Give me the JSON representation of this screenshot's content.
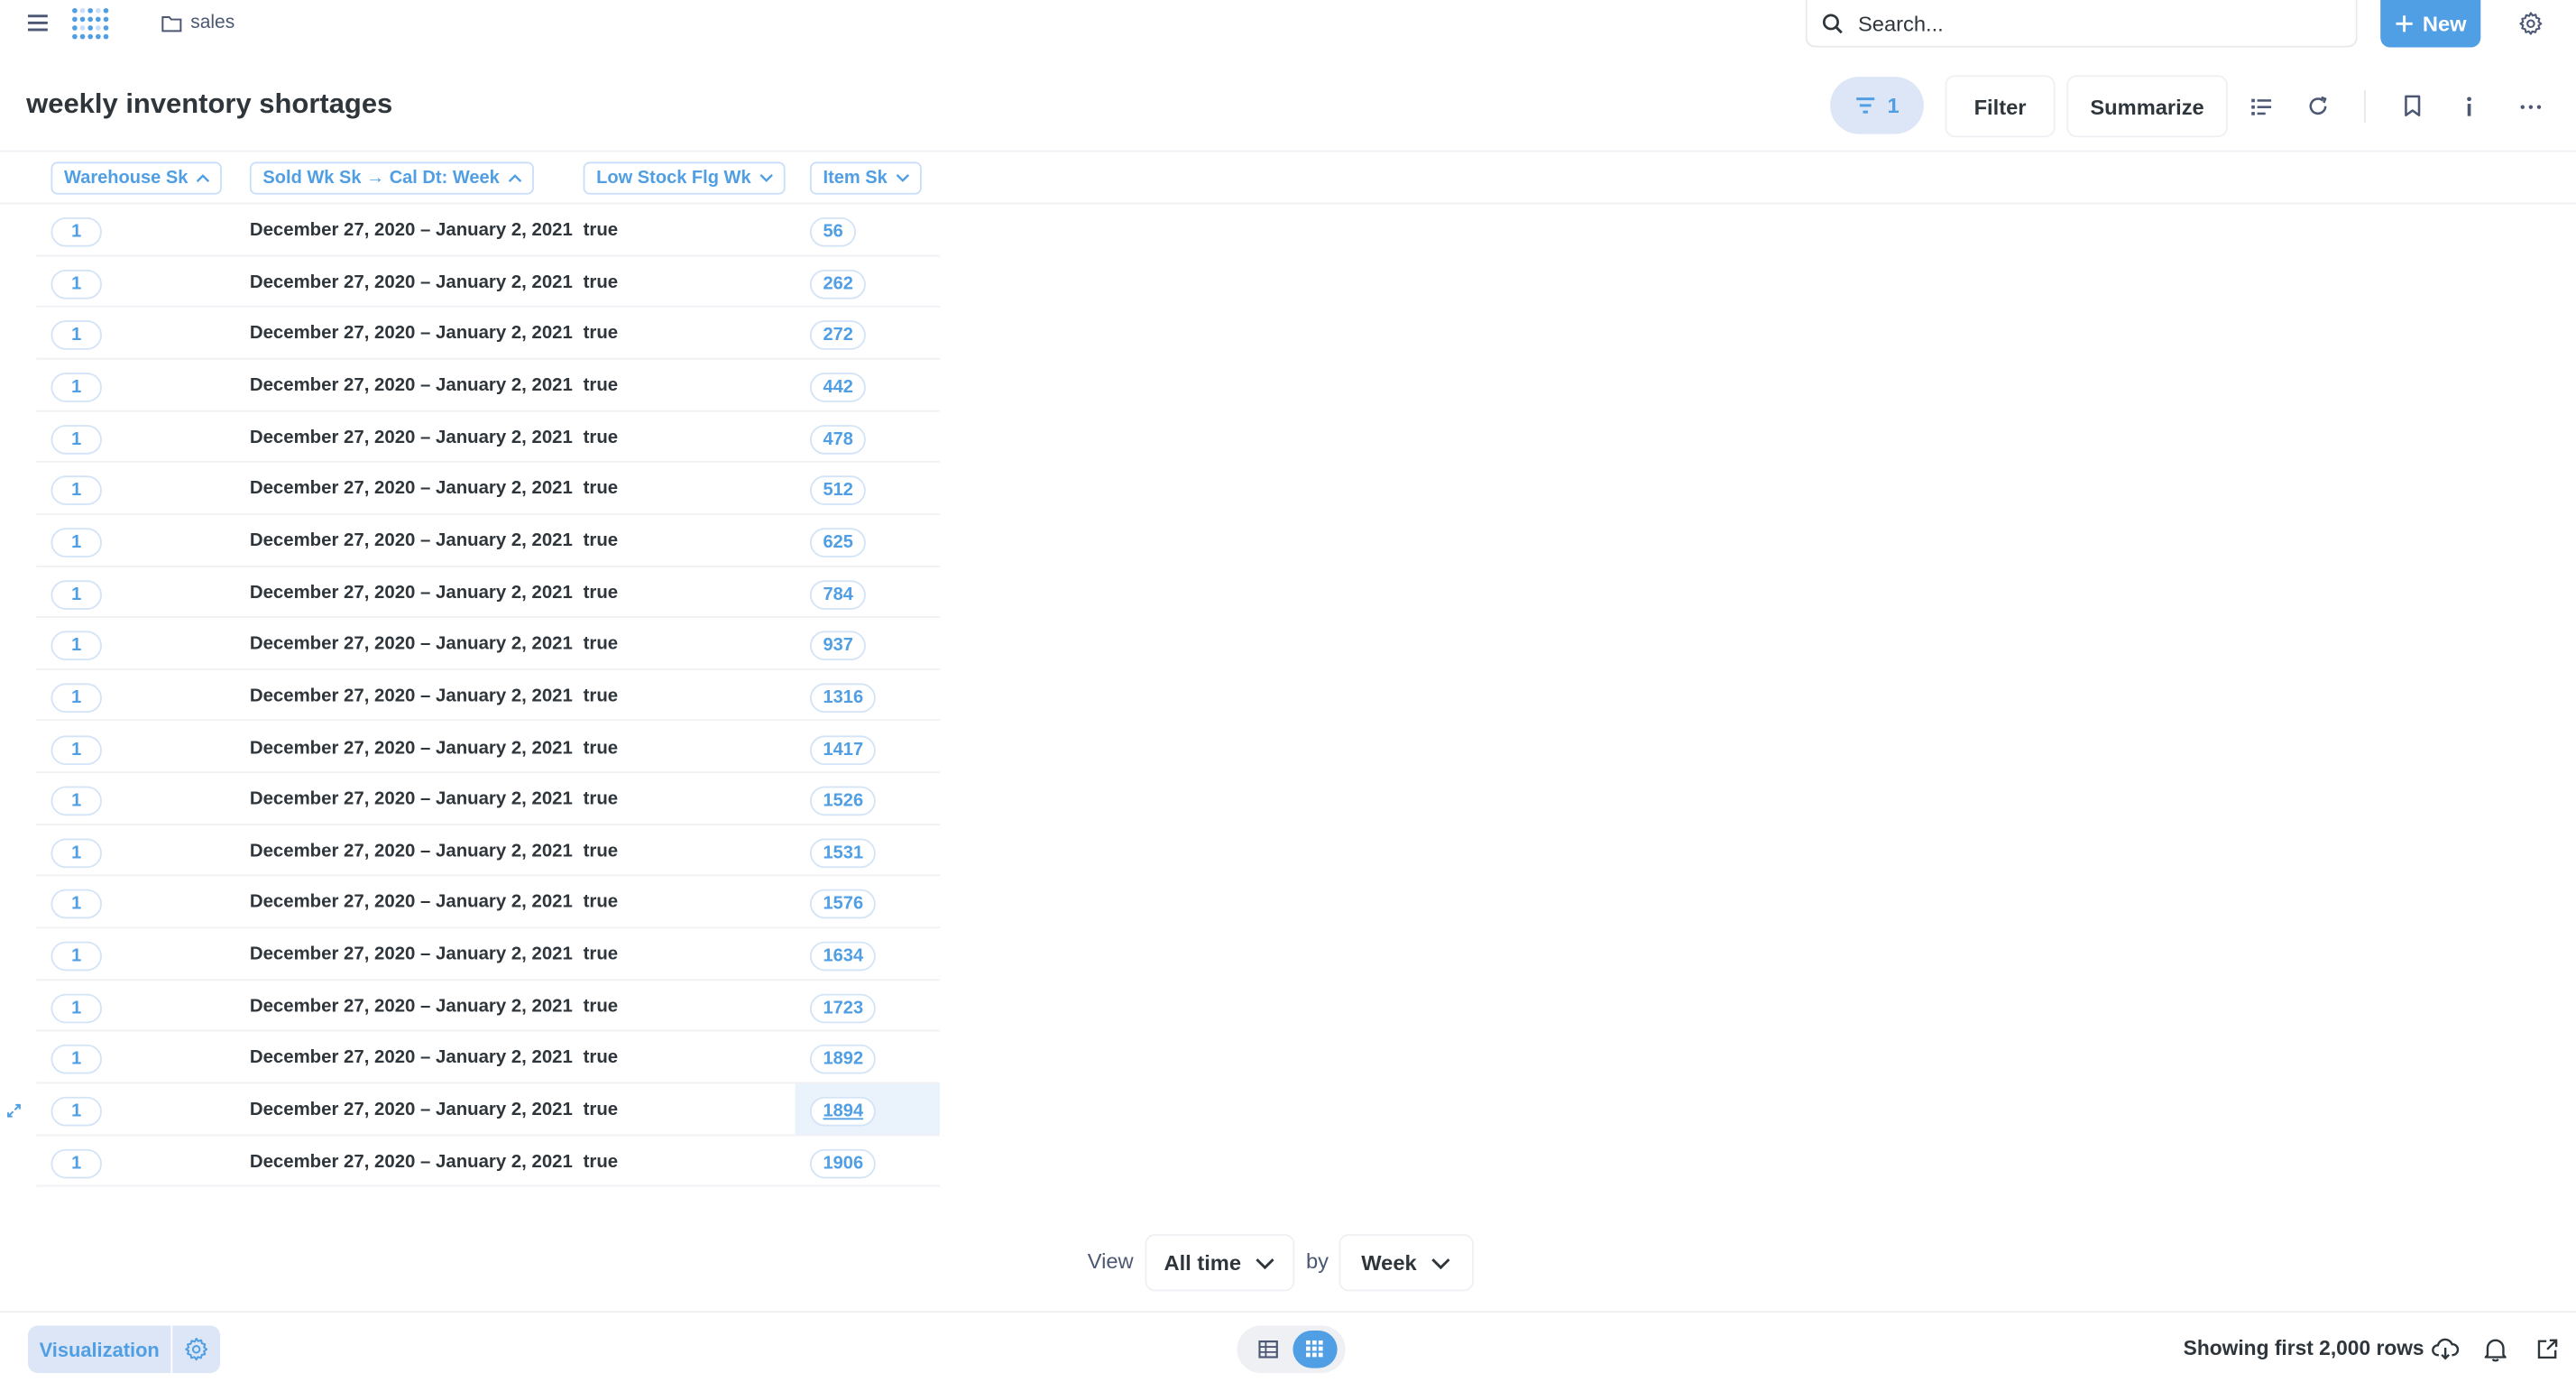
{
  "nav": {
    "breadcrumb": "sales",
    "search_placeholder": "Search...",
    "new_label": "New"
  },
  "header": {
    "title": "weekly inventory shortages",
    "filter_count": "1",
    "filter_label": "Filter",
    "summarize_label": "Summarize"
  },
  "table": {
    "columns": [
      {
        "label": "Warehouse Sk",
        "sort": "chevron-up"
      },
      {
        "label": "Sold Wk Sk → Cal Dt: Week",
        "sort": "chevron-up"
      },
      {
        "label": "Low Stock Flg Wk",
        "sort": "chevron-down"
      },
      {
        "label": "Item Sk",
        "sort": "chevron-down"
      }
    ],
    "rows": [
      [
        "1",
        "December 27, 2020 – January 2, 2021",
        "true",
        "56"
      ],
      [
        "1",
        "December 27, 2020 – January 2, 2021",
        "true",
        "262"
      ],
      [
        "1",
        "December 27, 2020 – January 2, 2021",
        "true",
        "272"
      ],
      [
        "1",
        "December 27, 2020 – January 2, 2021",
        "true",
        "442"
      ],
      [
        "1",
        "December 27, 2020 – January 2, 2021",
        "true",
        "478"
      ],
      [
        "1",
        "December 27, 2020 – January 2, 2021",
        "true",
        "512"
      ],
      [
        "1",
        "December 27, 2020 – January 2, 2021",
        "true",
        "625"
      ],
      [
        "1",
        "December 27, 2020 – January 2, 2021",
        "true",
        "784"
      ],
      [
        "1",
        "December 27, 2020 – January 2, 2021",
        "true",
        "937"
      ],
      [
        "1",
        "December 27, 2020 – January 2, 2021",
        "true",
        "1316"
      ],
      [
        "1",
        "December 27, 2020 – January 2, 2021",
        "true",
        "1417"
      ],
      [
        "1",
        "December 27, 2020 – January 2, 2021",
        "true",
        "1526"
      ],
      [
        "1",
        "December 27, 2020 – January 2, 2021",
        "true",
        "1531"
      ],
      [
        "1",
        "December 27, 2020 – January 2, 2021",
        "true",
        "1576"
      ],
      [
        "1",
        "December 27, 2020 – January 2, 2021",
        "true",
        "1634"
      ],
      [
        "1",
        "December 27, 2020 – January 2, 2021",
        "true",
        "1723"
      ],
      [
        "1",
        "December 27, 2020 – January 2, 2021",
        "true",
        "1892"
      ],
      [
        "1",
        "December 27, 2020 – January 2, 2021",
        "true",
        "1894"
      ],
      [
        "1",
        "December 27, 2020 – January 2, 2021",
        "true",
        "1906"
      ]
    ],
    "hovered_row": 17
  },
  "view_controls": {
    "view_label": "View",
    "time_value": "All time",
    "by_label": "by",
    "unit_value": "Week"
  },
  "footer": {
    "visualization_label": "Visualization",
    "row_count": "Showing first 2,000 rows"
  },
  "colors": {
    "brand": "#509ee3",
    "brand_light": "#dce6f6",
    "text_dark": "#2e353b"
  },
  "icons": [
    "hamburger-icon",
    "metabase-logo-icon",
    "folder-icon",
    "search-icon",
    "plus-icon",
    "gear-icon",
    "filter-icon",
    "notebook-icon",
    "refresh-icon",
    "bookmark-icon",
    "info-icon",
    "ellipsis-icon",
    "chevron-down-icon",
    "table-icon",
    "grid-icon",
    "download-icon",
    "bell-icon",
    "share-icon",
    "expand-icon"
  ]
}
